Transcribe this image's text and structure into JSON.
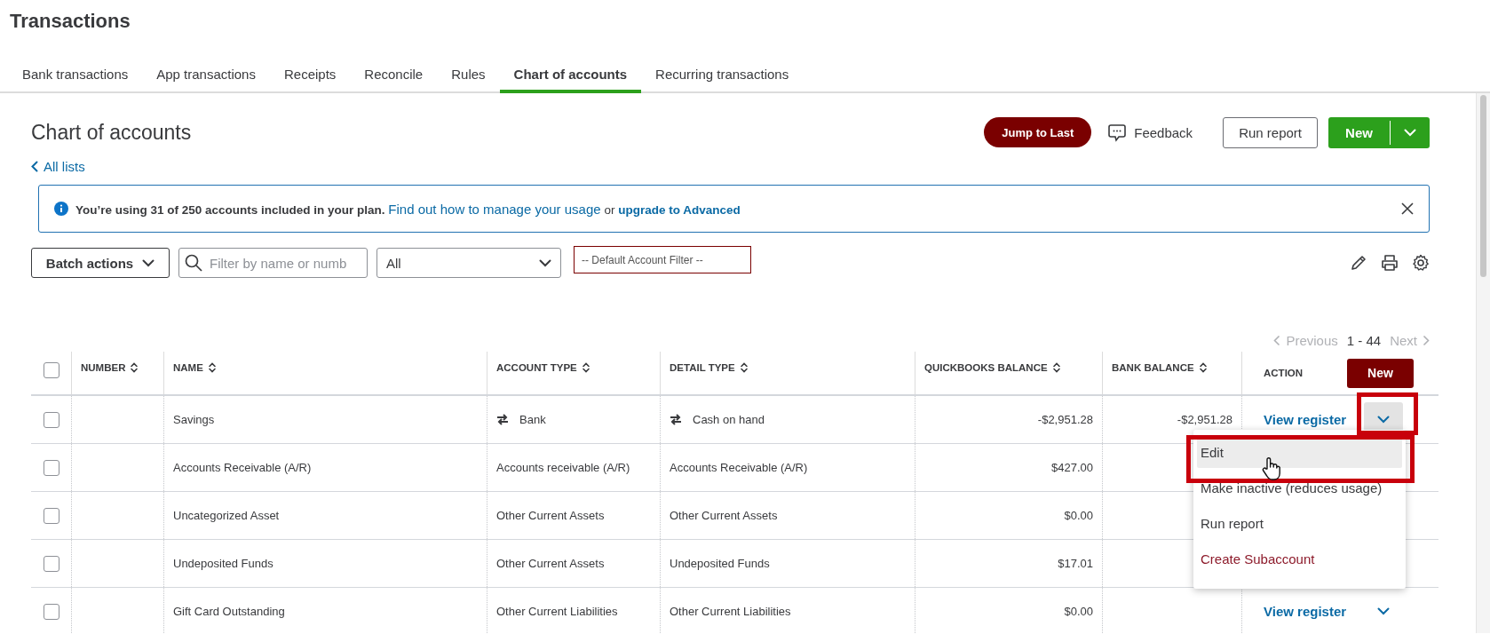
{
  "page_title": "Transactions",
  "tabs": [
    {
      "label": "Bank transactions",
      "selected": false
    },
    {
      "label": "App transactions",
      "selected": false
    },
    {
      "label": "Receipts",
      "selected": false
    },
    {
      "label": "Reconcile",
      "selected": false
    },
    {
      "label": "Rules",
      "selected": false
    },
    {
      "label": "Chart of accounts",
      "selected": true
    },
    {
      "label": "Recurring transactions",
      "selected": false
    }
  ],
  "heading": "Chart of accounts",
  "header_buttons": {
    "jump": "Jump to Last",
    "feedback": "Feedback",
    "run_report": "Run report",
    "new": "New"
  },
  "back_link": "All lists",
  "banner": {
    "text": "You’re using 31 of 250 accounts included in your plan.",
    "link": "Find out how to manage your usage",
    "joiner": "or",
    "upgrade": "upgrade to Advanced"
  },
  "filters": {
    "batch": "Batch actions",
    "search_placeholder": "Filter by name or numb",
    "type_value": "All",
    "account_filter": "-- Default Account Filter --"
  },
  "pagination": {
    "previous": "Previous",
    "range": "1 - 44",
    "next": "Next"
  },
  "table": {
    "select_all_checked": false,
    "columns": [
      {
        "label": "NUMBER",
        "sortable": true
      },
      {
        "label": "NAME",
        "sortable": true
      },
      {
        "label": "ACCOUNT TYPE",
        "sortable": true
      },
      {
        "label": "DETAIL TYPE",
        "sortable": true
      },
      {
        "label": "QUICKBOOKS BALANCE",
        "sortable": true
      },
      {
        "label": "BANK BALANCE",
        "sortable": true
      },
      {
        "label": "ACTION",
        "sortable": false
      }
    ],
    "new_button": "New",
    "rows": [
      {
        "checked": false,
        "name": "Savings",
        "linked": true,
        "account_type": "Bank",
        "detail_type": "Cash on hand",
        "qb_balance": "-$2,951.28",
        "bank_balance": "-$2,951.28",
        "action": "View register",
        "menu_open": true,
        "framed": true
      },
      {
        "checked": false,
        "name": "Accounts Receivable (A/R)",
        "linked": false,
        "account_type": "Accounts receivable (A/R)",
        "detail_type": "Accounts Receivable (A/R)",
        "qb_balance": "$427.00",
        "menu_open": false,
        "framed": false
      },
      {
        "checked": false,
        "name": "Uncategorized Asset",
        "linked": false,
        "account_type": "Other Current Assets",
        "detail_type": "Other Current Assets",
        "qb_balance": "$0.00",
        "menu_open": false,
        "framed": false
      },
      {
        "checked": false,
        "name": "Undeposited Funds",
        "linked": false,
        "account_type": "Other Current Assets",
        "detail_type": "Undeposited Funds",
        "qb_balance": "$17.01",
        "menu_open": false,
        "framed": false
      },
      {
        "checked": false,
        "name": "Gift Card Outstanding",
        "linked": false,
        "account_type": "Other Current Liabilities",
        "detail_type": "Other Current Liabilities",
        "qb_balance": "$0.00",
        "action": "View register",
        "menu_open": false,
        "framed": false
      }
    ]
  },
  "action_menu": [
    {
      "label": "Edit",
      "hovered": true,
      "framed": true,
      "color": "#393a3d"
    },
    {
      "label": "Make inactive (reduces usage)",
      "hovered": false,
      "framed": false,
      "color": "#393a3d"
    },
    {
      "label": "Run report",
      "hovered": false,
      "framed": false,
      "color": "#393a3d"
    },
    {
      "label": "Create Subaccount",
      "hovered": false,
      "framed": false,
      "color": "#8d1b2b"
    }
  ]
}
